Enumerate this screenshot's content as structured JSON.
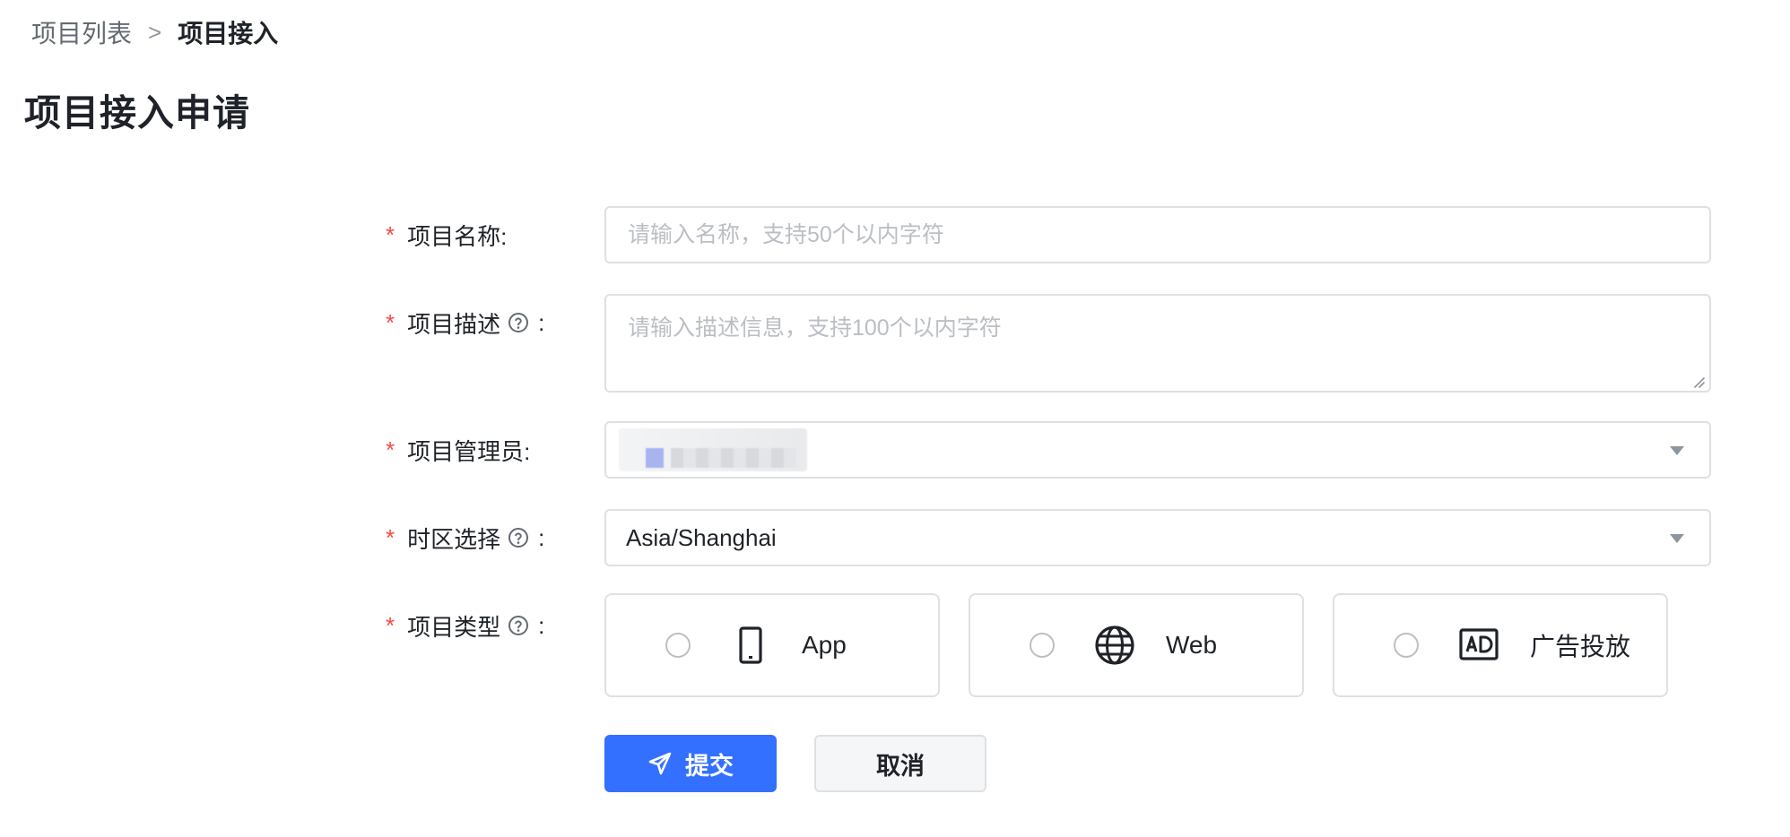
{
  "breadcrumb": {
    "parent": "项目列表",
    "separator": ">",
    "current": "项目接入"
  },
  "page_title": "项目接入申请",
  "form": {
    "name": {
      "label": "项目名称:",
      "required_mark": "*",
      "placeholder": "请输入名称，支持50个以内字符",
      "value": ""
    },
    "description": {
      "label": "项目描述",
      "required_mark": "*",
      "colon": ":",
      "help_icon": "question-circle-icon",
      "placeholder": "请输入描述信息，支持100个以内字符",
      "value": ""
    },
    "manager": {
      "label": "项目管理员:",
      "required_mark": "*"
    },
    "timezone": {
      "label": "时区选择",
      "required_mark": "*",
      "colon": ":",
      "help_icon": "question-circle-icon",
      "value": "Asia/Shanghai"
    },
    "project_type": {
      "label": "项目类型",
      "required_mark": "*",
      "colon": ":",
      "help_icon": "question-circle-icon",
      "options": [
        {
          "label": "App",
          "icon": "mobile-phone-icon"
        },
        {
          "label": "Web",
          "icon": "globe-icon"
        },
        {
          "label": "广告投放",
          "icon": "ad-icon"
        }
      ]
    }
  },
  "actions": {
    "submit_label": "提交",
    "cancel_label": "取消"
  },
  "colors": {
    "primary": "#3370ff",
    "required": "#f54a45",
    "border": "#dee0e3",
    "placeholder": "#bbbfc4",
    "text": "#1f2329"
  }
}
